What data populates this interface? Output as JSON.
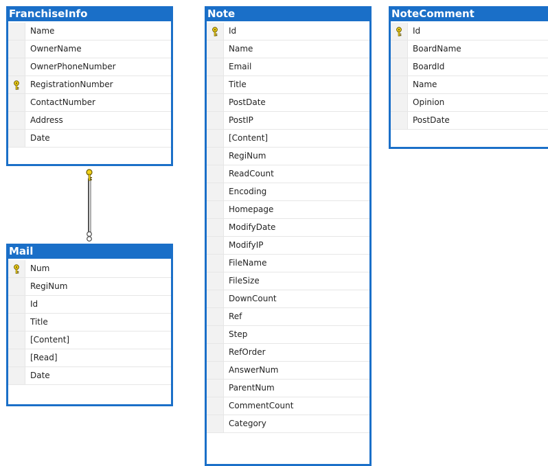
{
  "tables": [
    {
      "id": "franchiseinfo",
      "title": "FranchiseInfo",
      "columns": [
        {
          "name": "Name",
          "key": false
        },
        {
          "name": "OwnerName",
          "key": false
        },
        {
          "name": "OwnerPhoneNumber",
          "key": false
        },
        {
          "name": "RegistrationNumber",
          "key": true
        },
        {
          "name": "ContactNumber",
          "key": false
        },
        {
          "name": "Address",
          "key": false
        },
        {
          "name": "Date",
          "key": false
        }
      ]
    },
    {
      "id": "mail",
      "title": "Mail",
      "columns": [
        {
          "name": "Num",
          "key": true
        },
        {
          "name": "RegiNum",
          "key": false
        },
        {
          "name": "Id",
          "key": false
        },
        {
          "name": "Title",
          "key": false
        },
        {
          "name": "[Content]",
          "key": false
        },
        {
          "name": "[Read]",
          "key": false
        },
        {
          "name": "Date",
          "key": false
        }
      ]
    },
    {
      "id": "note",
      "title": "Note",
      "columns": [
        {
          "name": "Id",
          "key": true
        },
        {
          "name": "Name",
          "key": false
        },
        {
          "name": "Email",
          "key": false
        },
        {
          "name": "Title",
          "key": false
        },
        {
          "name": "PostDate",
          "key": false
        },
        {
          "name": "PostIP",
          "key": false
        },
        {
          "name": "[Content]",
          "key": false
        },
        {
          "name": "RegiNum",
          "key": false
        },
        {
          "name": "ReadCount",
          "key": false
        },
        {
          "name": "Encoding",
          "key": false
        },
        {
          "name": "Homepage",
          "key": false
        },
        {
          "name": "ModifyDate",
          "key": false
        },
        {
          "name": "ModifyIP",
          "key": false
        },
        {
          "name": "FileName",
          "key": false
        },
        {
          "name": "FileSize",
          "key": false
        },
        {
          "name": "DownCount",
          "key": false
        },
        {
          "name": "Ref",
          "key": false
        },
        {
          "name": "Step",
          "key": false
        },
        {
          "name": "RefOrder",
          "key": false
        },
        {
          "name": "AnswerNum",
          "key": false
        },
        {
          "name": "ParentNum",
          "key": false
        },
        {
          "name": "CommentCount",
          "key": false
        },
        {
          "name": "Category",
          "key": false
        }
      ]
    },
    {
      "id": "notecomment",
      "title": "NoteComment",
      "columns": [
        {
          "name": "Id",
          "key": true
        },
        {
          "name": "BoardName",
          "key": false
        },
        {
          "name": "BoardId",
          "key": false
        },
        {
          "name": "Name",
          "key": false
        },
        {
          "name": "Opinion",
          "key": false
        },
        {
          "name": "PostDate",
          "key": false
        }
      ]
    }
  ],
  "relationships": [
    {
      "from": "franchiseinfo",
      "to": "mail",
      "from_end": "one",
      "to_end": "many"
    }
  ],
  "colors": {
    "header": "#1a6fc8",
    "key_fill": "#f2d21b",
    "key_stroke": "#6b5a00",
    "connector": "#555555"
  }
}
